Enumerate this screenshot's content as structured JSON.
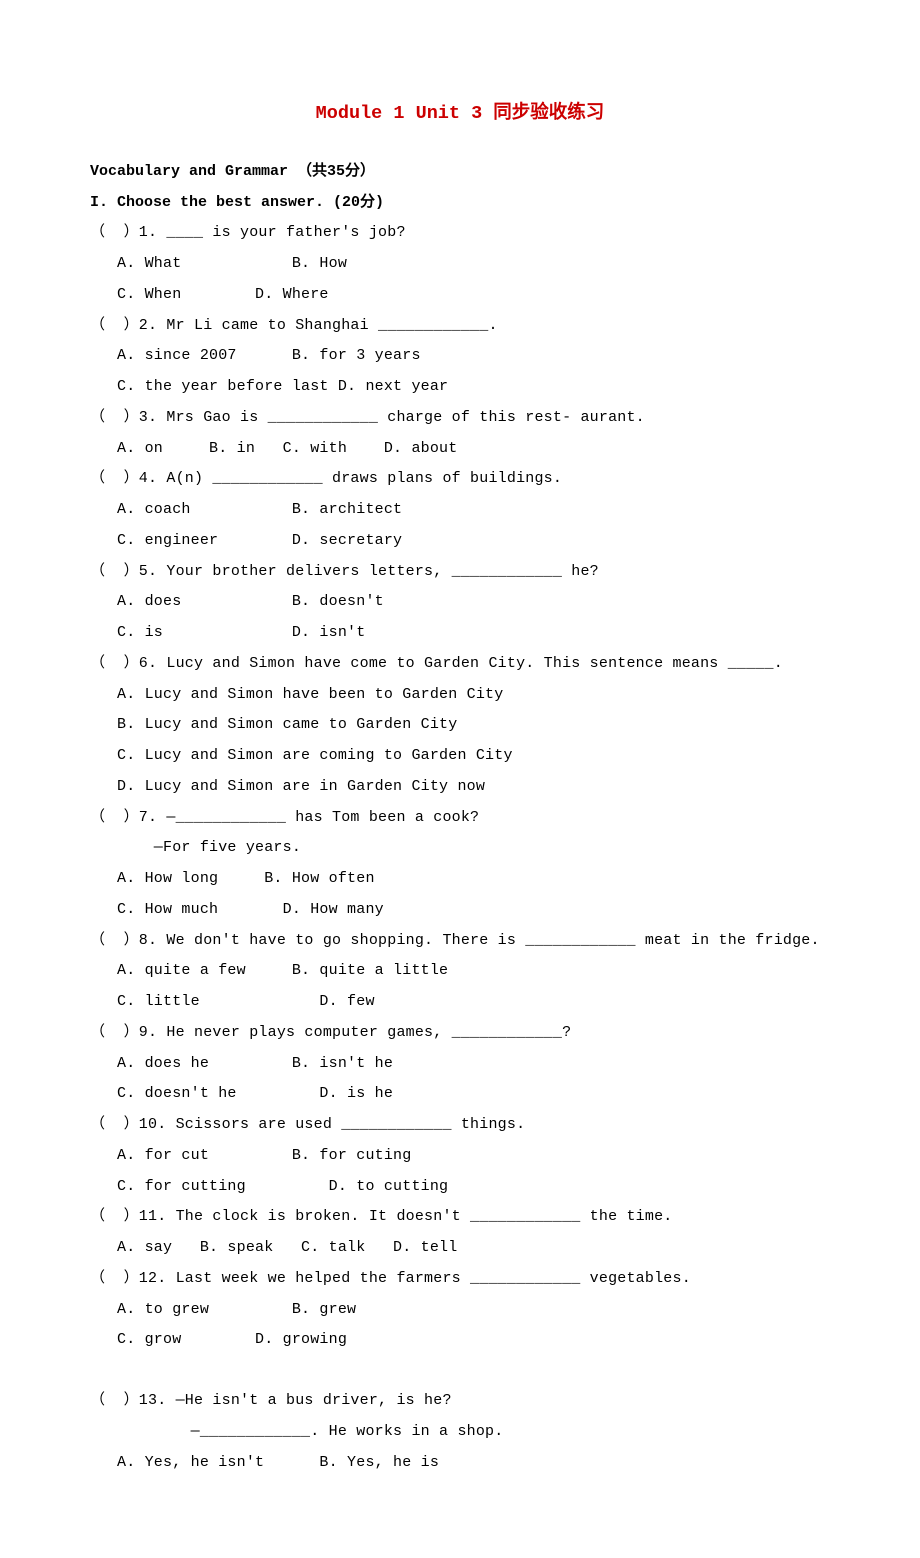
{
  "title": "Module 1 Unit 3 同步验收练习",
  "section_header": "Vocabulary and Grammar （共35分）",
  "sub_header": "I. Choose the best answer.  (20分)",
  "questions": [
    {
      "stem": "（  ）1. ____ is your father's job?",
      "options": [
        "A. What            B. How",
        "C. When        D. Where"
      ]
    },
    {
      "stem": "（  ）2. Mr Li came to Shanghai ____________.",
      "options": [
        "A. since 2007      B. for 3 years",
        "C. the year before last D. next year"
      ]
    },
    {
      "stem": "（  ）3. Mrs Gao is ____________ charge of this rest- aurant.",
      "options": [
        "A. on     B. in   C. with    D. about"
      ]
    },
    {
      "stem": "（  ）4. A(n) ____________ draws plans of buildings.",
      "options": [
        "A. coach           B. architect",
        "C. engineer        D. secretary"
      ]
    },
    {
      "stem": "（  ）5. Your brother delivers letters, ____________ he?",
      "options": [
        "A. does            B. doesn't",
        "C. is              D. isn't"
      ]
    },
    {
      "stem": "（  ）6. Lucy and Simon have come to Garden City. This sentence means _____.",
      "options": [
        "A. Lucy and Simon have been to Garden City",
        "B. Lucy and Simon came to Garden City",
        "C. Lucy and Simon are coming to Garden City",
        "D. Lucy and Simon are in Garden City now"
      ]
    },
    {
      "stem": "（  ）7. —____________ has Tom been a cook?",
      "extra": "    —For five years.",
      "options": [
        "A. How long     B. How often",
        "C. How much       D. How many"
      ]
    },
    {
      "stem": "（  ）8. We don't have to go shopping. There is ____________ meat in the fridge.",
      "options": [
        "A. quite a few     B. quite a little",
        "C. little             D. few"
      ]
    },
    {
      "stem": "（  ）9. He never plays computer games, ____________?",
      "options": [
        "A. does he         B. isn't he",
        "C. doesn't he         D. is he"
      ]
    },
    {
      "stem": "（  ）10. Scissors are used ____________ things.",
      "options": [
        "A. for cut         B. for cuting",
        "C. for cutting         D. to cutting"
      ]
    },
    {
      "stem": "（  ）11. The clock is broken. It doesn't ____________ the time.",
      "options": [
        "A. say   B. speak   C. talk   D. tell"
      ]
    },
    {
      "stem": "（  ）12. Last week we helped the farmers ____________ vegetables.",
      "options": [
        "A. to grew         B. grew",
        "C. grow        D. growing"
      ]
    },
    {
      "stem": "（  ）13. —He isn't a bus driver, is he?",
      "extra": "        —____________. He works in a shop.",
      "options": [
        "A. Yes, he isn't      B. Yes, he is"
      ]
    }
  ]
}
